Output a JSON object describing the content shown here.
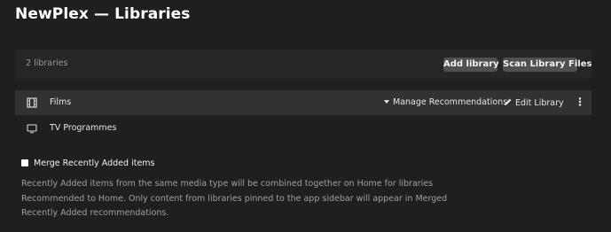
{
  "header": {
    "title": "NewPlex — Libraries"
  },
  "toolbar": {
    "library_count": "2 libraries",
    "add_label": "Add library",
    "scan_label": "Scan Library Files"
  },
  "libraries": [
    {
      "name": "Films",
      "icon": "film-icon",
      "actions": {
        "recommendations": "Manage Recommendations",
        "edit": "Edit Library",
        "more": "⋮"
      }
    },
    {
      "name": "TV Programmes",
      "icon": "monitor-icon"
    }
  ],
  "merge": {
    "label": "Merge Recently Added items",
    "checked": false,
    "description": [
      "Recently Added items from the same media type will be combined together on Home for libraries",
      "Recommended to Home. Only content from libraries pinned to the app sidebar will appear in Merged",
      "Recently Added recommendations."
    ]
  }
}
